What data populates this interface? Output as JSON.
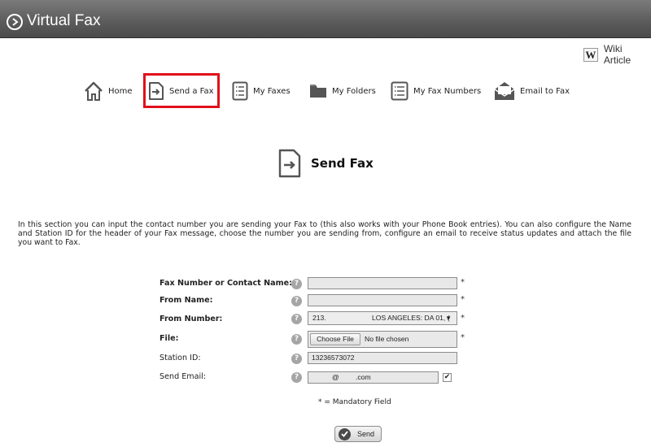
{
  "app": {
    "title": "Virtual Fax"
  },
  "wiki": {
    "icon_letter": "W",
    "label": "Wiki Article"
  },
  "nav": {
    "items": [
      {
        "label": "Home",
        "icon": "home-icon"
      },
      {
        "label": "Send a Fax",
        "icon": "send-fax-icon",
        "selected": true
      },
      {
        "label": "My Faxes",
        "icon": "list-icon"
      },
      {
        "label": "My Folders",
        "icon": "folder-icon"
      },
      {
        "label": "My Fax Numbers",
        "icon": "list-icon"
      },
      {
        "label": "Email to Fax",
        "icon": "envelope-icon"
      }
    ],
    "highlight_color": "#e0101b"
  },
  "page": {
    "heading": "Send Fax",
    "intro": "In this section you can input the contact number you are sending your Fax to (this also works with your Phone Book entries). You can also configure the Name and Station ID for the header of your Fax message, choose the number you are sending from, configure an email to receive status updates and attach the file you want to Fax."
  },
  "form": {
    "fax_number_label": "Fax Number or Contact Name:",
    "fax_number_value": "",
    "from_name_label": "From Name:",
    "from_name_value": "",
    "from_number_label": "From Number:",
    "from_number_code": "213.",
    "from_number_city": "LOS ANGELES: DA 01, (",
    "file_label": "File:",
    "choose_file_label": "Choose File",
    "file_status": "No file chosen",
    "station_id_label": "Station ID:",
    "station_id_value": "13236573072",
    "send_email_label": "Send Email:",
    "email_at": "@",
    "email_domain": ".com",
    "send_email_checked": true,
    "required_mark": "*",
    "help_mark": "?",
    "mandatory_note": "* = Mandatory Field",
    "send_label": "Send"
  }
}
